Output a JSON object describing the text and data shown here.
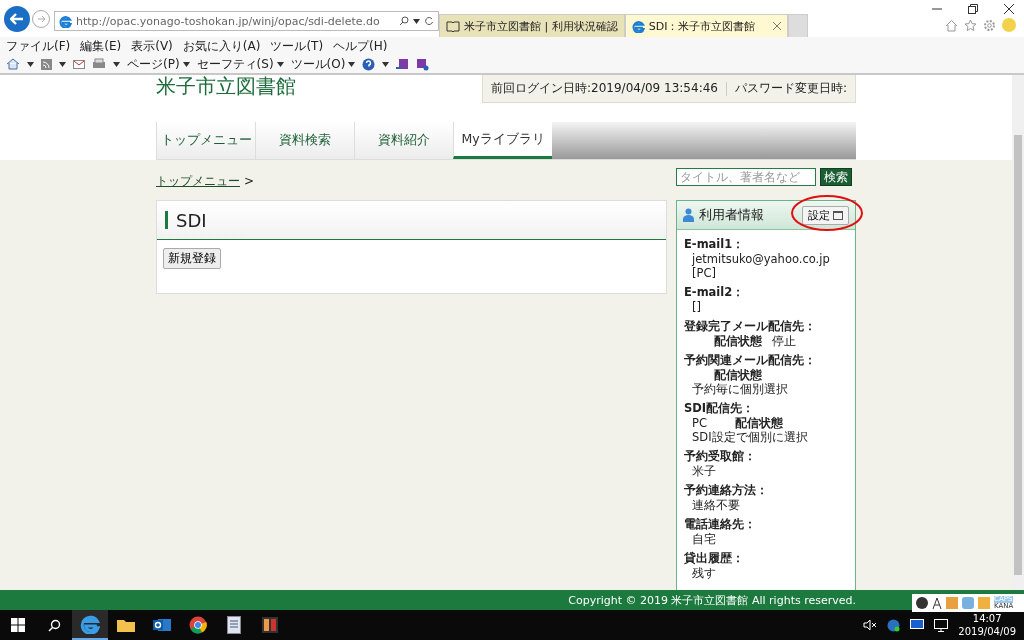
{
  "browser": {
    "address": "http://opac.yonago-toshokan.jp/winj/opac/sdi-delete.do",
    "tabs": [
      {
        "label": "米子市立図書館 | 利用状況確認",
        "selected": false
      },
      {
        "label": "SDI：米子市立図書館",
        "selected": true
      }
    ],
    "menu": [
      "ファイル(F)",
      "編集(E)",
      "表示(V)",
      "お気に入り(A)",
      "ツール(T)",
      "ヘルプ(H)"
    ],
    "commands": [
      "ページ(P)",
      "セーフティ(S)",
      "ツール(O)"
    ]
  },
  "site": {
    "logo": "米子市立図書館",
    "login_info": "前回ログイン日時:2019/04/09 13:54:46",
    "password_info": "パスワード変更日時:",
    "nav": [
      {
        "label": "トップメニュー",
        "selected": false
      },
      {
        "label": "資料検索",
        "selected": false
      },
      {
        "label": "資料紹介",
        "selected": false
      },
      {
        "label": "Myライブラリ",
        "selected": true
      }
    ],
    "breadcrumb": {
      "link": "トップメニュー",
      "separator": ">"
    },
    "search": {
      "placeholder": "タイトル、著者名など",
      "button": "検索"
    }
  },
  "main_panel": {
    "title": "SDI",
    "button": "新規登録"
  },
  "user_panel": {
    "title": "利用者情報",
    "settings_button": "設定",
    "fields": [
      {
        "label": "E-mail1：",
        "values": [
          "jetmitsuko@yahoo.co.jp [PC]"
        ]
      },
      {
        "label": "E-mail2：",
        "values": [
          "[]"
        ]
      },
      {
        "label": "登録完了メール配信先：",
        "status_label": "配信状態",
        "status": "停止"
      },
      {
        "label": "予約関連メール配信先：",
        "status_label": "配信状態",
        "status": "予約毎に個別選択"
      },
      {
        "label": "SDI配信先：",
        "values": [
          "PC"
        ],
        "status_label": "配信状態",
        "status": "SDI設定で個別に選択"
      },
      {
        "label": "予約受取館：",
        "values": [
          "米子"
        ]
      },
      {
        "label": "予約連絡方法：",
        "values": [
          "連絡不要"
        ]
      },
      {
        "label": "電話連絡先：",
        "values": [
          "自宅"
        ]
      },
      {
        "label": "貸出履歴：",
        "values": [
          "残す"
        ]
      }
    ]
  },
  "footer": "Copyright © 2019 米子市立図書館 All rights reserved.",
  "ime_bar": {
    "caps": "CAPS",
    "kana": "KANA"
  },
  "taskbar": {
    "time": "14:07",
    "date": "2019/04/09"
  }
}
